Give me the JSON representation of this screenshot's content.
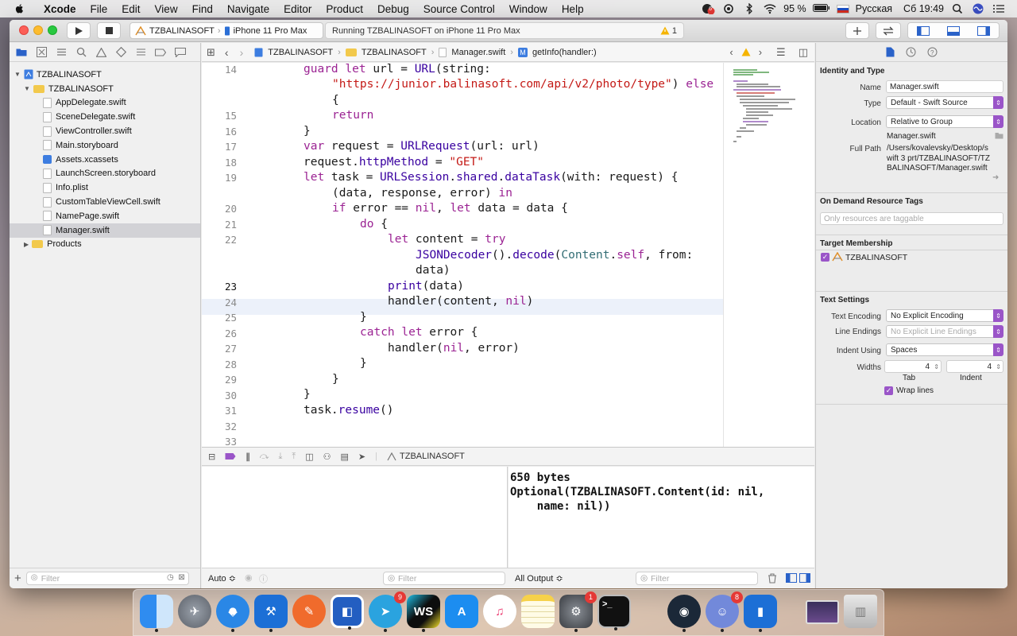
{
  "menubar": {
    "app": "Xcode",
    "items": [
      "File",
      "Edit",
      "View",
      "Find",
      "Navigate",
      "Editor",
      "Product",
      "Debug",
      "Source Control",
      "Window",
      "Help"
    ],
    "notification_badge": "6",
    "battery": "95 %",
    "input_source": "Русская",
    "clock": "Сб 19:49"
  },
  "toolbar": {
    "scheme": "TZBALINASOFT",
    "device": "iPhone 11 Pro Max",
    "status": "Running TZBALINASOFT on iPhone 11 Pro Max",
    "warnings": "1"
  },
  "navigator": {
    "project": "TZBALINASOFT",
    "group": "TZBALINASOFT",
    "files": [
      "AppDelegate.swift",
      "SceneDelegate.swift",
      "ViewController.swift",
      "Main.storyboard",
      "Assets.xcassets",
      "LaunchScreen.storyboard",
      "Info.plist",
      "CustomTableViewCell.swift",
      "NamePage.swift",
      "Manager.swift"
    ],
    "products": "Products",
    "filter_placeholder": "Filter"
  },
  "jumpbar": {
    "crumbs": [
      "TZBALINASOFT",
      "TZBALINASOFT",
      "Manager.swift",
      "getInfo(handler:)"
    ]
  },
  "editor": {
    "line_numbers": [
      "14",
      "",
      "",
      "15",
      "16",
      "17",
      "18",
      "19",
      "",
      "20",
      "21",
      "22",
      "",
      "",
      "23",
      "24",
      "25",
      "26",
      "27",
      "28",
      "29",
      "30",
      "31",
      "32",
      "33"
    ],
    "current_line": "23"
  },
  "debug": {
    "target": "TZBALINASOFT",
    "auto_label": "Auto ≎",
    "filter_placeholder": "Filter",
    "output_label": "All Output ≎",
    "console": "650 bytes\nOptional(TZBALINASOFT.Content(id: nil,\n    name: nil))"
  },
  "inspector": {
    "identity_title": "Identity and Type",
    "name_label": "Name",
    "name_value": "Manager.swift",
    "type_label": "Type",
    "type_value": "Default - Swift Source",
    "location_label": "Location",
    "location_value": "Relative to Group",
    "location_file": "Manager.swift",
    "fullpath_label": "Full Path",
    "fullpath_value": "/Users/kovalevsky/Desktop/swift 3 prt/TZBALINASOFT/TZBALINASOFT/Manager.swift",
    "odr_title": "On Demand Resource Tags",
    "odr_placeholder": "Only resources are taggable",
    "target_title": "Target Membership",
    "target_name": "TZBALINASOFT",
    "text_title": "Text Settings",
    "encoding_label": "Text Encoding",
    "encoding_value": "No Explicit Encoding",
    "endings_label": "Line Endings",
    "endings_value": "No Explicit Line Endings",
    "indent_label": "Indent Using",
    "indent_value": "Spaces",
    "widths_label": "Widths",
    "tab_value": "4",
    "indent_width_value": "4",
    "tab_caption": "Tab",
    "indent_caption": "Indent",
    "wrap_label": "Wrap lines"
  },
  "dock": {
    "badges": {
      "telegram": "9",
      "sysprefs": "1",
      "discord": "8"
    },
    "terminal_prompt": ">_",
    "webstorm": "WS"
  },
  "colors": {
    "keyword": "#9b2393",
    "string": "#c41a16",
    "type": "#3900a0",
    "identifier": "#326d74",
    "selection_accent": "#9a55c8"
  }
}
